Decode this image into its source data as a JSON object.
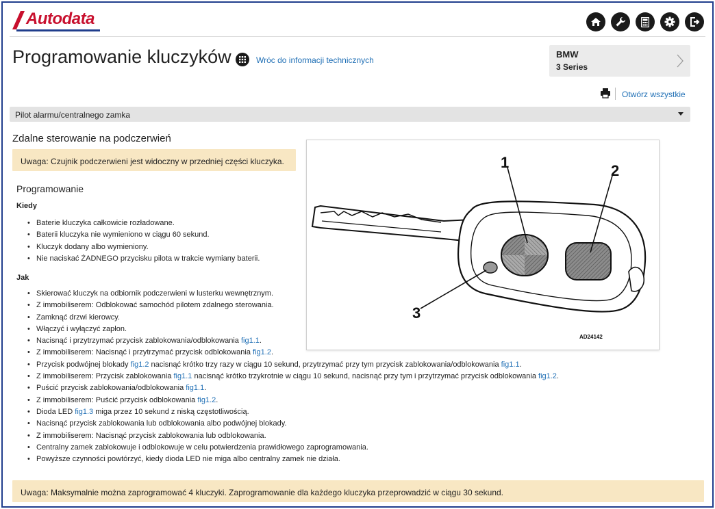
{
  "brand": {
    "name": "Autodata",
    "color": "#c8102e"
  },
  "topbar": {
    "icons": [
      "home-icon",
      "wrench-icon",
      "calculator-icon",
      "gear-icon",
      "logout-icon"
    ]
  },
  "page": {
    "title": "Programowanie kluczyków",
    "back_link": "Wróc do informacji technicznych"
  },
  "vehicle": {
    "make": "BMW",
    "model": "3 Series"
  },
  "toolbar": {
    "open_all": "Otwórz wszystkie"
  },
  "dropdown": {
    "selected": "Pilot alarmu/centralnego zamka"
  },
  "section": {
    "title": "Zdalne sterowanie na podczerwień",
    "note_top": "Uwaga: Czujnik podczerwieni jest widoczny w przedniej części kluczyka.",
    "subtitle": "Programowanie",
    "when_label": "Kiedy",
    "when_items": [
      "Baterie kluczyka całkowicie rozładowane.",
      "Baterii kluczyka nie wymieniono w ciągu 60 sekund.",
      "Kluczyk dodany albo wymieniony.",
      "Nie naciskać ŻADNEGO przycisku pilota w trakcie wymiany baterii."
    ],
    "how_label": "Jak",
    "how_items": [
      {
        "pre": "Skierować kluczyk na odbiornik podczerwieni w lusterku wewnętrznym."
      },
      {
        "pre": "Z immobiliserem: Odblokować samochód pilotem zdalnego sterowania."
      },
      {
        "pre": "Zamknąć drzwi kierowcy."
      },
      {
        "pre": "Włączyć i wyłączyć zapłon."
      },
      {
        "pre": "Nacisnąć i przytrzymać przycisk zablokowania/odblokowania ",
        "link1": "fig1.1",
        "post": "."
      },
      {
        "pre": "Z immobiliserem: Nacisnąć i przytrzymać przycisk odblokowania ",
        "link1": "fig1.2",
        "post": "."
      },
      {
        "pre": "Przycisk podwójnej blokady ",
        "link1": "fig1.2",
        "mid": " nacisnąć krótko trzy razy w ciągu 10 sekund, przytrzymać przy tym przycisk zablokowania/odblokowania ",
        "link2": "fig1.1",
        "post": "."
      },
      {
        "pre": "Z immobiliserem: Przycisk zablokowania ",
        "link1": "fig1.1",
        "mid": " nacisnąć krótko trzykrotnie w ciągu 10 sekund, nacisnąć przy tym i przytrzymać przycisk odblokowania ",
        "link2": "fig1.2",
        "post": "."
      },
      {
        "pre": "Puścić przycisk zablokowania/odblokowania ",
        "link1": "fig1.1",
        "post": "."
      },
      {
        "pre": "Z immobiliserem: Puścić przycisk odblokowania ",
        "link1": "fig1.2",
        "post": "."
      },
      {
        "pre": "Dioda LED ",
        "link1": "fig1.3",
        "post": " miga przez 10 sekund z niską częstotliwością."
      },
      {
        "pre": "Nacisnąć przycisk zablokowania lub odblokowania albo podwójnej blokady."
      },
      {
        "pre": "Z immobiliserem: Nacisnąć przycisk zablokowania lub odblokowania."
      },
      {
        "pre": "Centralny zamek zablokowuje i odblokowuje w celu potwierdzenia prawidłowego zaprogramowania."
      },
      {
        "pre": "Powyższe czynności powtórzyć, kiedy dioda LED nie miga albo centralny zamek nie działa."
      }
    ],
    "note_bottom": "Uwaga: Maksymalnie można zaprogramować 4 kluczyki. Zaprogramowanie dla każdego kluczyka przeprowadzić w ciągu 30 sekund."
  },
  "figure": {
    "labels": [
      "1",
      "2",
      "3"
    ],
    "code": "AD24142"
  },
  "colors": {
    "link": "#1f6fb5",
    "note_bg": "#f8e7c3",
    "frame": "#1f3d8c"
  }
}
